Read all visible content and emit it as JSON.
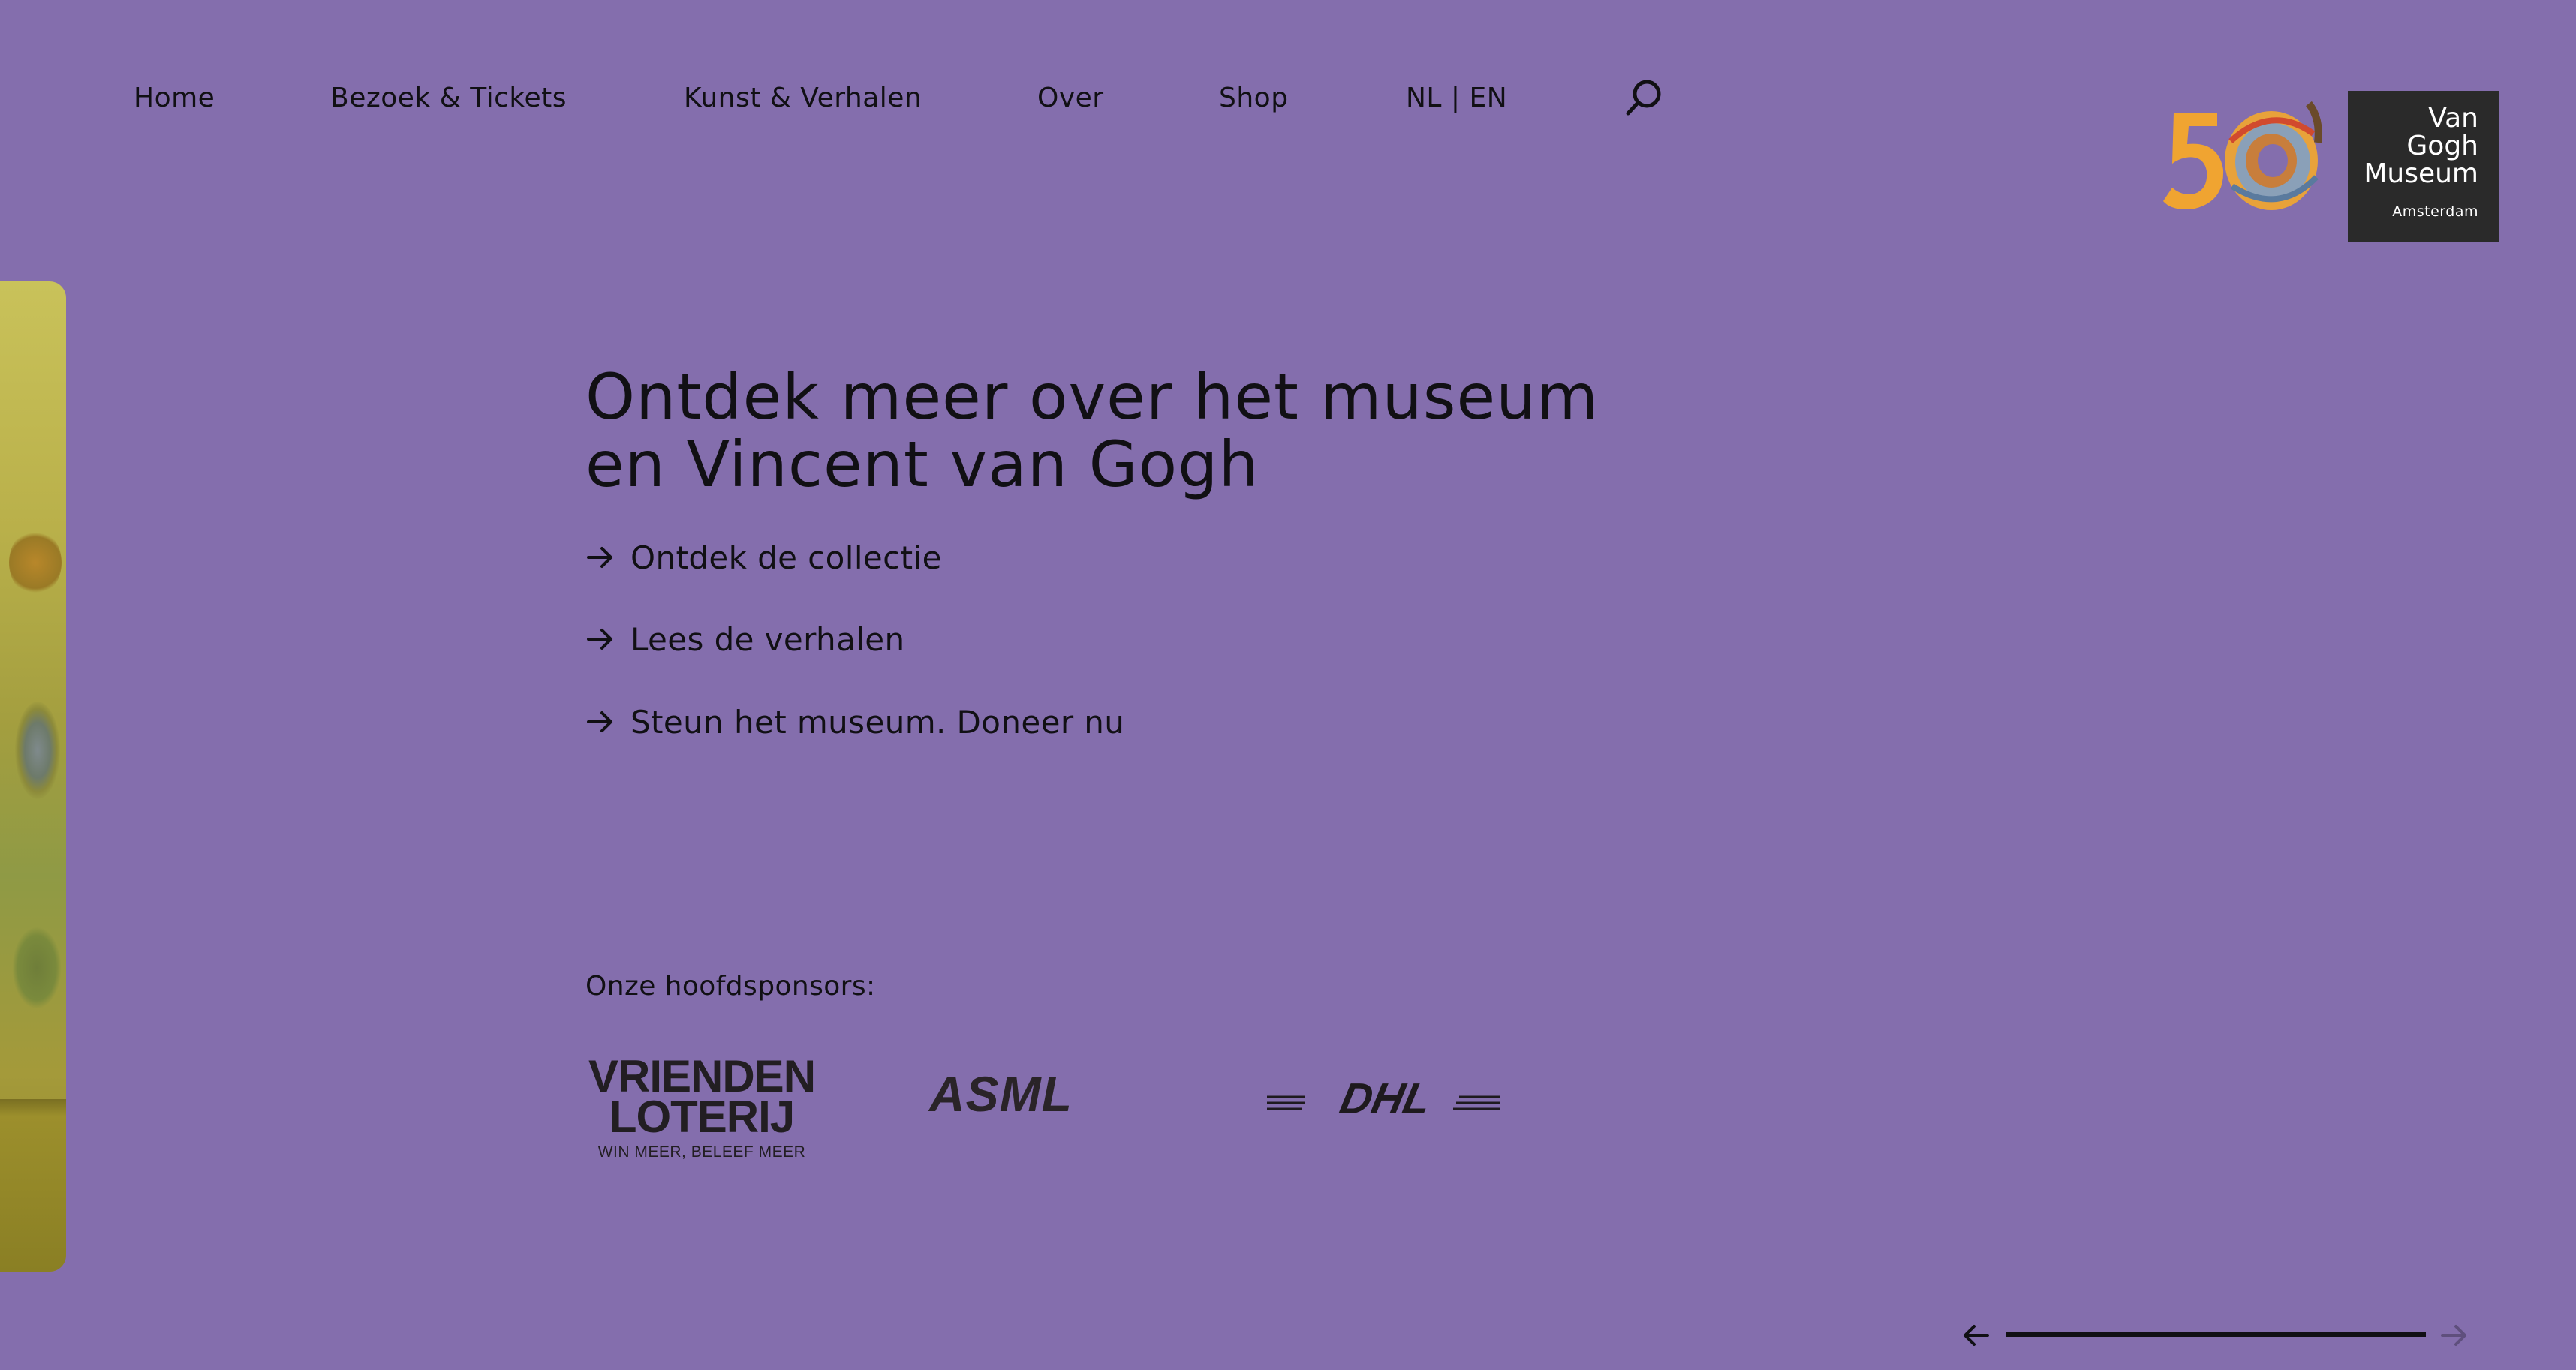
{
  "nav": {
    "items": [
      "Home",
      "Bezoek & Tickets",
      "Kunst & Verhalen",
      "Over",
      "Shop",
      "NL | EN"
    ],
    "search_icon": "search-icon"
  },
  "logo": {
    "lines": [
      "Van",
      "Gogh",
      "Museum"
    ],
    "city": "Amsterdam",
    "anniversary": "50"
  },
  "hero": {
    "headline_line1": "Ontdek meer over het museum",
    "headline_line2": "en Vincent van Gogh",
    "links": [
      "Ontdek de collectie",
      "Lees de verhalen",
      "Steun het museum. Doneer nu"
    ]
  },
  "sponsors": {
    "label": "Onze hoofdsponsors:",
    "vrienden": {
      "line1": "VRIENDEN",
      "line2": "LOTERIJ",
      "tagline": "WIN MEER, BELEEF MEER"
    },
    "asml": "ASML",
    "dhl": "DHL"
  },
  "slider": {
    "progress": 1.0,
    "prev_icon": "arrow-left-icon",
    "next_icon": "arrow-right-icon"
  },
  "colors": {
    "background": "#846ead",
    "text": "#111014",
    "logo_box": "#2a2a2a",
    "logo_accent": "#f0a431"
  }
}
